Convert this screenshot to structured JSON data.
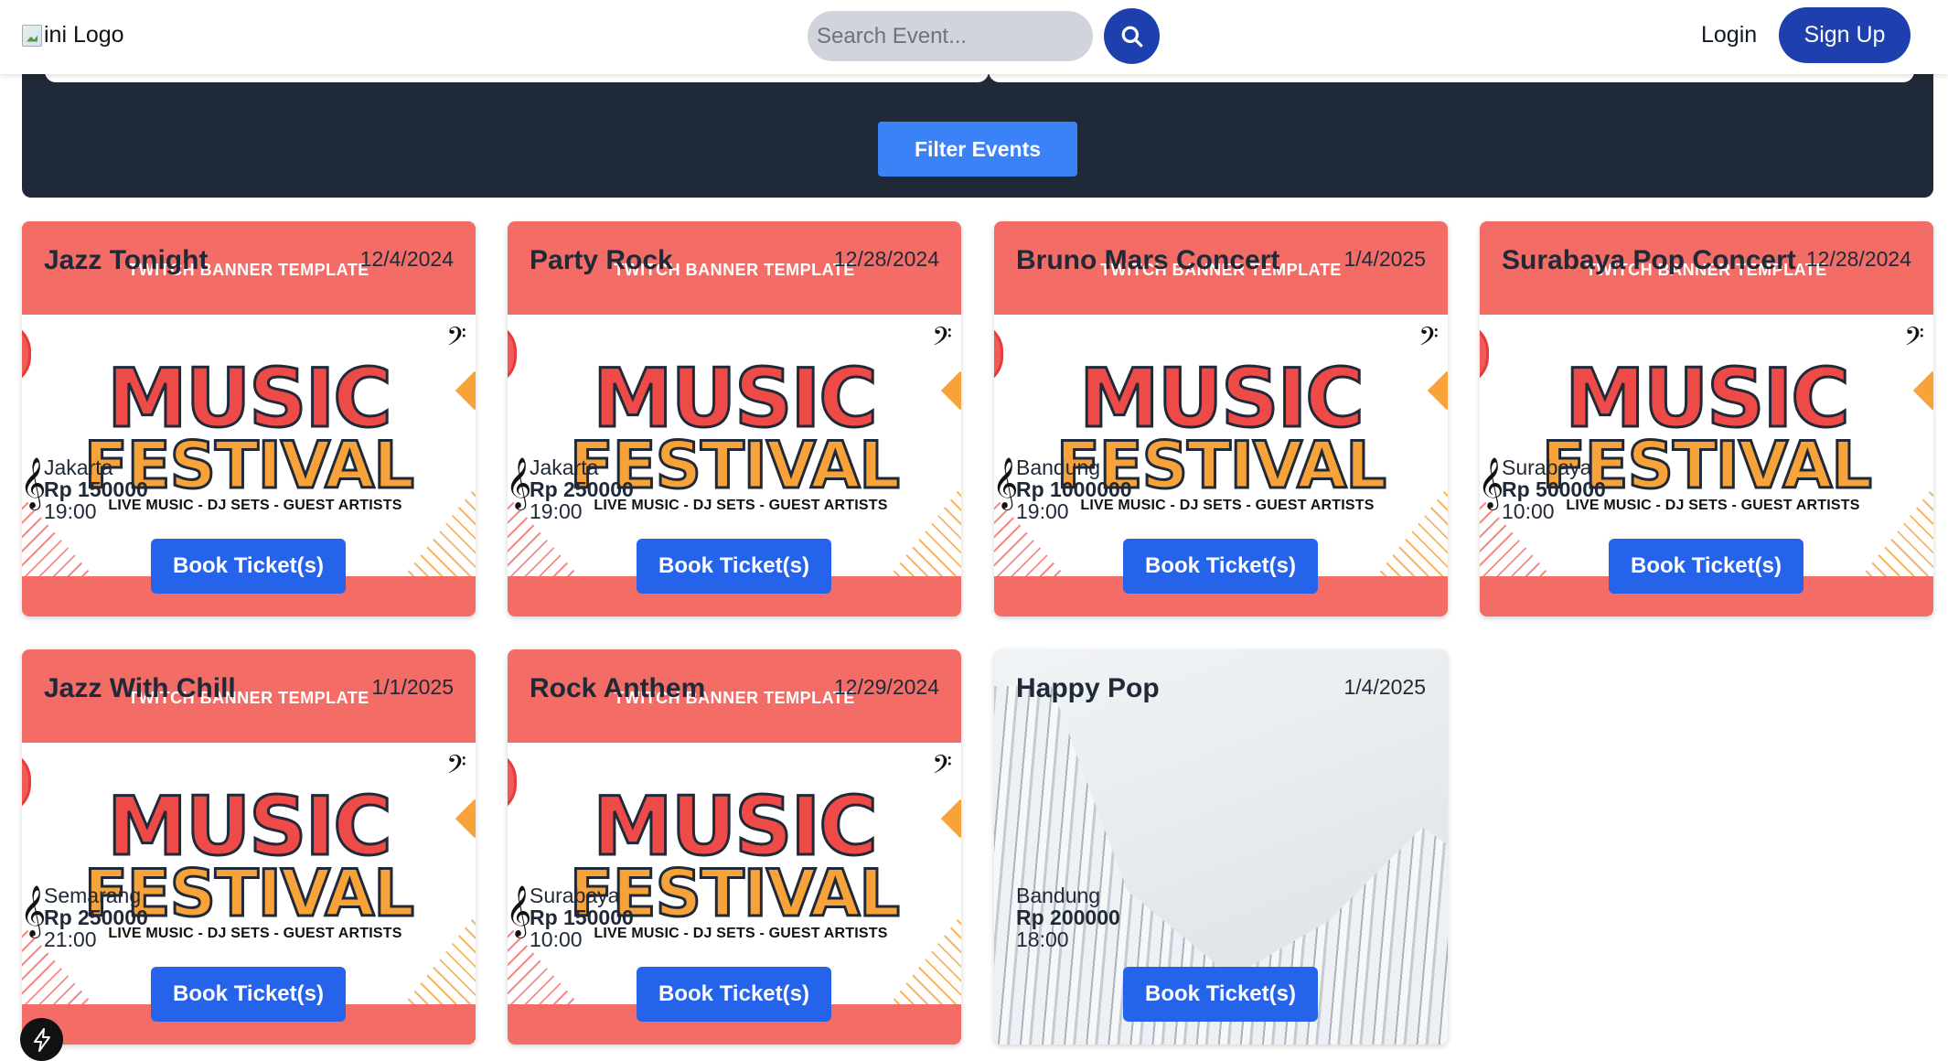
{
  "header": {
    "logo_alt": "ini Logo",
    "search_placeholder": "Search Event...",
    "login_label": "Login",
    "signup_label": "Sign Up"
  },
  "filter": {
    "button_label": "Filter Events"
  },
  "banner": {
    "top_text": "TWITCH BANNER TEMPLATE",
    "title_line1": "MUSIC",
    "title_line2": "FESTIVAL",
    "tagline": "LIVE MUSIC - DJ SETS - GUEST ARTISTS"
  },
  "book_label": "Book Ticket(s)",
  "events": [
    {
      "title": "Jazz Tonight",
      "date": "12/4/2024",
      "city": "Jakarta",
      "price": "Rp 150000",
      "time": "19:00",
      "image": "music-festival-banner"
    },
    {
      "title": "Party Rock",
      "date": "12/28/2024",
      "city": "Jakarta",
      "price": "Rp 250000",
      "time": "19:00",
      "image": "music-festival-banner"
    },
    {
      "title": "Bruno Mars Concert",
      "date": "1/4/2025",
      "city": "Bandung",
      "price": "Rp 1000000",
      "time": "19:00",
      "image": "music-festival-banner"
    },
    {
      "title": "Surabaya Pop Concert",
      "date": "12/28/2024",
      "city": "Surabaya",
      "price": "Rp 500000",
      "time": "10:00",
      "image": "music-festival-banner"
    },
    {
      "title": "Jazz With Chill",
      "date": "1/1/2025",
      "city": "Semarang",
      "price": "Rp 250000",
      "time": "21:00",
      "image": "music-festival-banner"
    },
    {
      "title": "Rock Anthem",
      "date": "12/29/2024",
      "city": "Surabaya",
      "price": "Rp 150000",
      "time": "10:00",
      "image": "music-festival-banner"
    },
    {
      "title": "Happy Pop",
      "date": "1/4/2025",
      "city": "Bandung",
      "price": "Rp 200000",
      "time": "18:00",
      "image": "architecture-photo"
    }
  ],
  "colors": {
    "brand_blue": "#1e40af",
    "button_blue": "#2563eb",
    "filter_blue": "#3b82f6",
    "panel_dark": "#1f2937",
    "banner_coral": "#f36c66",
    "banner_orange": "#f7a33a"
  }
}
